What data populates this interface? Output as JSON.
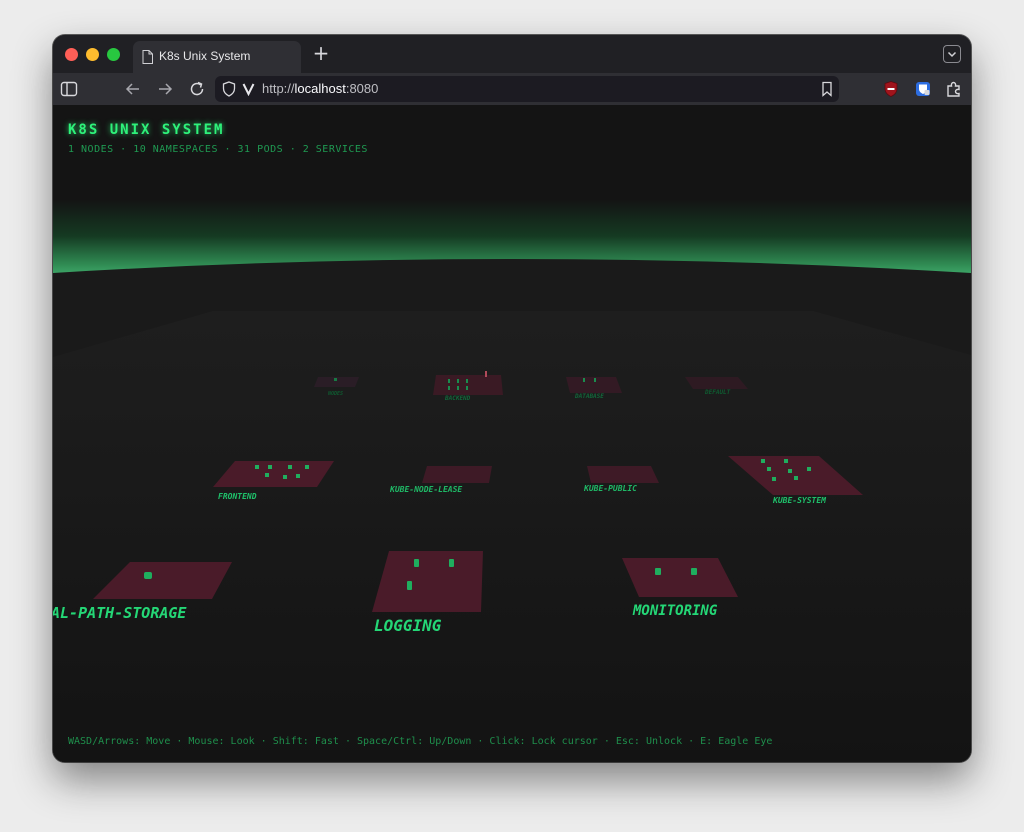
{
  "browser": {
    "tab_title": "K8s Unix System",
    "url_scheme": "http://",
    "url_host": "localhost",
    "url_port": ":8080"
  },
  "hud": {
    "title": "K8S UNIX SYSTEM",
    "stats": "1 NODES · 10 NAMESPACES · 31 PODS · 2 SERVICES",
    "help": "WASD/Arrows: Move · Mouse: Look · Shift: Fast · Space/Ctrl: Up/Down · Click: Lock cursor · Esc: Unlock · E: Eagle Eye"
  },
  "namespaces": [
    {
      "label": "NODES"
    },
    {
      "label": "BACKEND"
    },
    {
      "label": "DATABASE"
    },
    {
      "label": "DEFAULT"
    },
    {
      "label": "FRONTEND"
    },
    {
      "label": "KUBE-NODE-LEASE"
    },
    {
      "label": "KUBE-PUBLIC"
    },
    {
      "label": "KUBE-SYSTEM"
    },
    {
      "label": "AL-PATH-STORAGE"
    },
    {
      "label": "LOGGING"
    },
    {
      "label": "MONITORING"
    }
  ],
  "colors": {
    "hud_green": "#2ef27a",
    "platform": "#4a1b29",
    "pod": "#1fae5e",
    "horizon": "#3fb36e"
  }
}
